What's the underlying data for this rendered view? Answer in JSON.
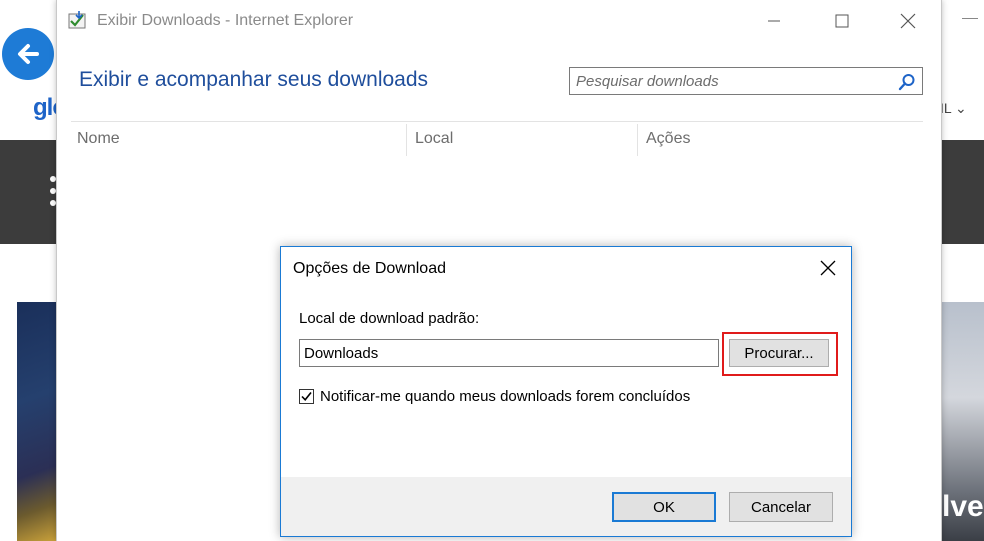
{
  "background": {
    "logo_text": "glo",
    "right_text": "IL",
    "image_text": "lve",
    "colors": {
      "back_button": "#1e7bd6",
      "dark_bar": "#3c3c3c"
    }
  },
  "window": {
    "title": "Exibir Downloads - Internet Explorer",
    "heading": "Exibir e acompanhar seus downloads",
    "search_placeholder": "Pesquisar downloads",
    "columns": [
      "Nome",
      "Local",
      "Ações"
    ],
    "icons": {
      "app": "ie-downloads-icon",
      "minimize": "minimize-icon",
      "maximize": "maximize-icon",
      "close": "close-icon",
      "search": "search-icon"
    }
  },
  "dialog": {
    "title": "Opções de Download",
    "location_label": "Local de download padrão:",
    "location_value": "Downloads",
    "browse_label": "Procurar...",
    "notify_label": "Notificar-me quando meus downloads forem concluídos",
    "notify_checked": true,
    "ok_label": "OK",
    "cancel_label": "Cancelar",
    "colors": {
      "accent": "#1a7ad4",
      "highlight": "#e01b1b"
    }
  }
}
